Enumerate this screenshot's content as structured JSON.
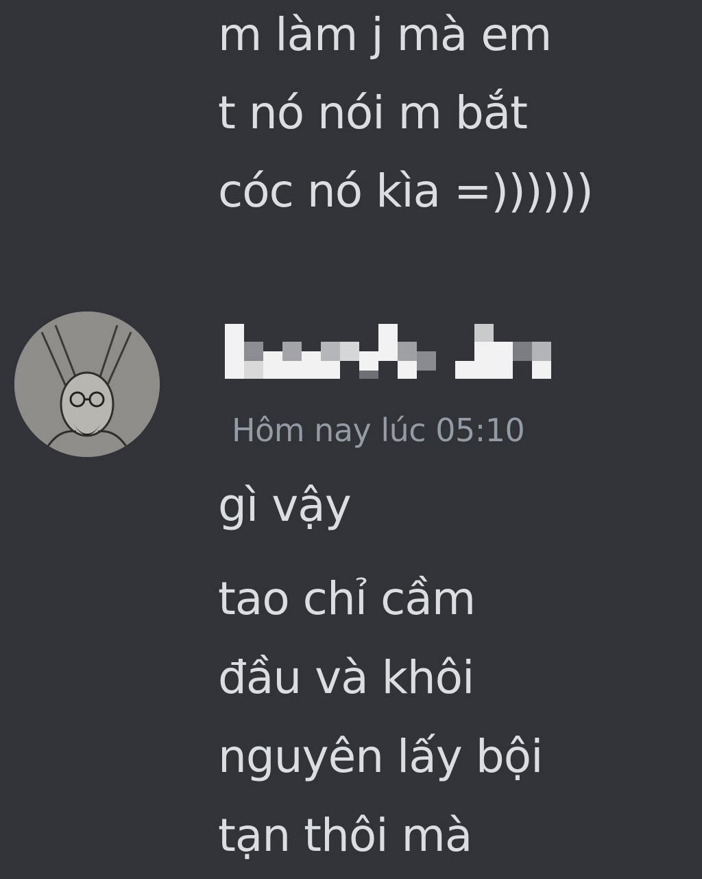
{
  "previous_message": {
    "lines": [
      "m làm j mà em",
      "t nó nói m bắt",
      "cóc nó kìa =))))))"
    ]
  },
  "message_group": {
    "author": {
      "avatar_icon": "avatar-sketch-portrait",
      "username_obscured": true
    },
    "timestamp": "Hôm nay lúc 05:10",
    "messages": [
      {
        "text": "gì vậy"
      },
      {
        "lines": [
          "tao chỉ cầm",
          "đầu và khôi",
          "nguyên lấy bội",
          "tạn thôi mà"
        ]
      }
    ]
  },
  "colors": {
    "background": "#313338",
    "message_text": "#dbdee1",
    "timestamp_text": "#949ba4"
  }
}
